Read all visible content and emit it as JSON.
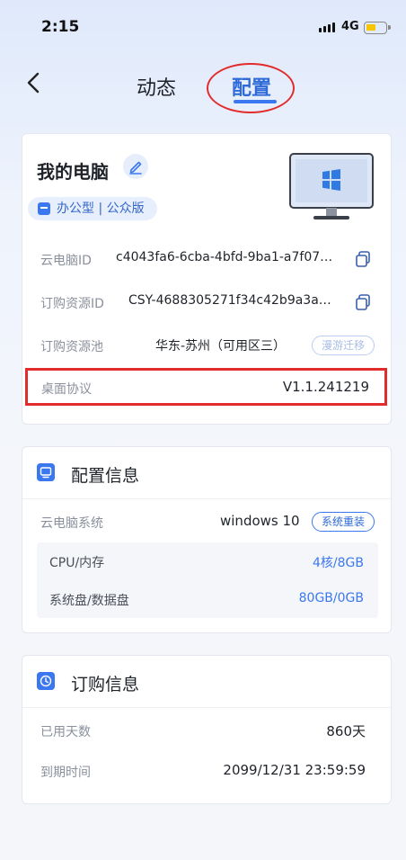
{
  "status_bar": {
    "time": "2:15",
    "network": "4G"
  },
  "nav": {
    "back_icon": "chevron-left-icon",
    "tabs": [
      {
        "label": "动态",
        "active": false
      },
      {
        "label": "配置",
        "active": true
      }
    ]
  },
  "computer": {
    "name": "我的电脑",
    "type_badge": "办公型 | 公众版",
    "fields": {
      "cloud_pc_id": {
        "label": "云电脑ID",
        "value": "c4043fa6-6cba-4bfd-9ba1-a7f07…"
      },
      "resource_id": {
        "label": "订购资源ID",
        "value": "CSY-4688305271f34c42b9a3a…"
      },
      "resource_pool": {
        "label": "订购资源池",
        "value": "华东-苏州（可用区三）",
        "action": "漫游迁移"
      },
      "protocol": {
        "label": "桌面协议",
        "value": "V1.1.241219"
      }
    }
  },
  "config_info": {
    "title": "配置信息",
    "system": {
      "label": "云电脑系统",
      "value": "windows 10",
      "action": "系统重装"
    },
    "specs": [
      {
        "label": "CPU/内存",
        "value": "4核/8GB"
      },
      {
        "label": "系统盘/数据盘",
        "value": "80GB/0GB"
      }
    ]
  },
  "order_info": {
    "title": "订购信息",
    "rows": [
      {
        "label": "已用天数",
        "value": "860天"
      },
      {
        "label": "到期时间",
        "value": "2099/12/31 23:59:59"
      }
    ]
  },
  "colors": {
    "accent": "#3b78f0",
    "highlight": "#e22b2b",
    "battery": "#f7c600"
  }
}
